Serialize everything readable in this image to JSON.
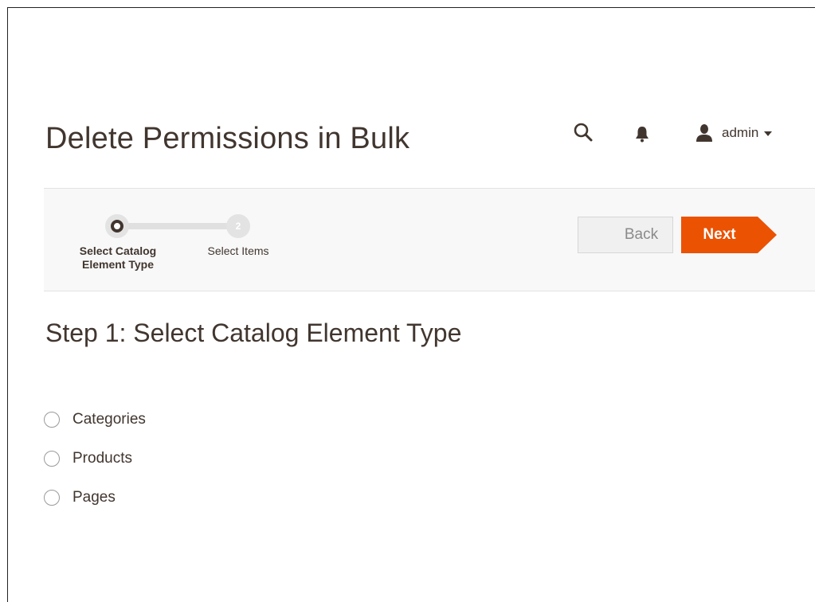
{
  "header": {
    "title": "Delete Permissions in Bulk",
    "user": "admin",
    "icons": [
      "search-icon",
      "bell-icon",
      "user-icon"
    ]
  },
  "wizard": {
    "steps": [
      {
        "number": "",
        "label_line1": "Select Catalog",
        "label_line2": "Element Type",
        "state": "active"
      },
      {
        "number": "2",
        "label": "Select Items",
        "state": "pending"
      }
    ],
    "back_label": "Back",
    "next_label": "Next",
    "accent_color": "#eb5202"
  },
  "main": {
    "heading": "Step 1: Select Catalog Element Type",
    "options": [
      "Categories",
      "Products",
      "Pages"
    ]
  }
}
